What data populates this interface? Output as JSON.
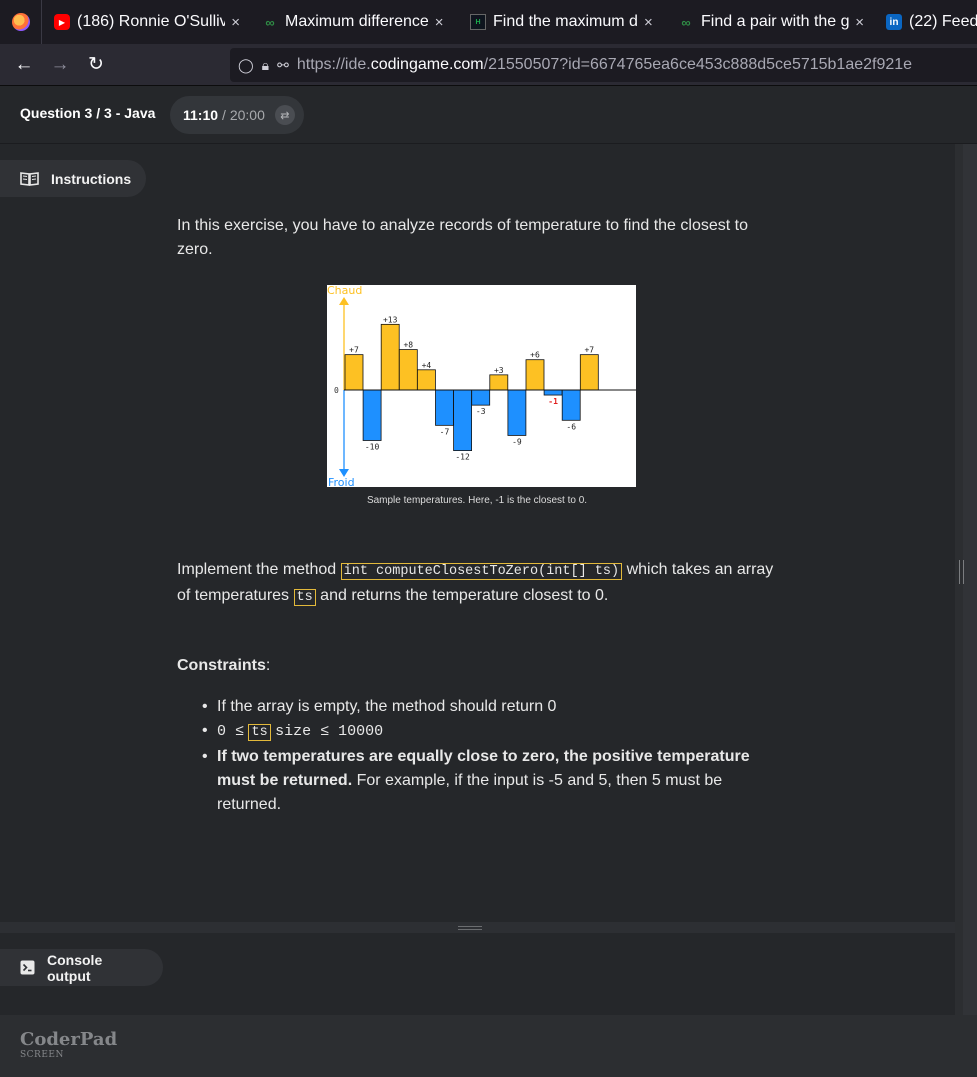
{
  "browser": {
    "tabs": [
      {
        "favicon": "youtube-icon",
        "title": "(186) Ronnie O'Sulliv"
      },
      {
        "favicon": "geeksforgeeks-icon",
        "title": "Maximum difference"
      },
      {
        "favicon": "hackerrank-icon",
        "title": "Find the maximum d"
      },
      {
        "favicon": "geeksforgeeks-icon",
        "title": "Find a pair with the g"
      },
      {
        "favicon": "linkedin-icon",
        "title": "(22) Feed"
      }
    ],
    "url_prefix": "https://ide.",
    "url_domain": "codingame.com",
    "url_path": "/21550507?id=6674765ea6ce453c888d5ce5715b1ae2f921e"
  },
  "header": {
    "question": "Question 3 / 3 - Java",
    "timer_current": "11:10",
    "timer_total": "/ 20:00"
  },
  "instructions": {
    "tab_label": "Instructions",
    "intro": "In this exercise, you have to analyze records of temperature to find the closest to zero.",
    "caption": "Sample temperatures. Here, -1 is the closest to 0.",
    "impl_before": "Implement the method",
    "impl_method": "int computeClosestToZero(int[] ts)",
    "impl_middle": "which takes an array of temperatures",
    "impl_param": "ts",
    "impl_after": "and returns the temperature closest to 0.",
    "constraints_title": "Constraints",
    "constraints_colon": ":",
    "c1": "If the array is empty, the method should return 0",
    "c2_before": "0 ≤",
    "c2_param": "ts",
    "c2_after": "size ≤ 10000",
    "c3_bold": "If two temperatures are equally close to zero, the positive temperature must be returned.",
    "c3_rest": "For example, if the input is -5 and 5, then 5 must be returned."
  },
  "console": {
    "tab_label": "Console output"
  },
  "footer": {
    "brand": "CoderPad",
    "sub": "SCREEN"
  },
  "chart_data": {
    "type": "bar",
    "top_label": "Chaud",
    "bottom_label": "Froid",
    "zero_label": "0",
    "values": [
      7,
      -10,
      13,
      8,
      4,
      -7,
      -12,
      -3,
      3,
      -9,
      6,
      -1,
      -6,
      7
    ],
    "labels": [
      "+7",
      "-10",
      "+13",
      "+8",
      "+4",
      "-7",
      "-12",
      "-3",
      "+3",
      "-9",
      "+6",
      "-1",
      "-6",
      "+7"
    ],
    "highlight": "-1",
    "colors": {
      "positive": "#fdc123",
      "negative": "#1e90ff",
      "highlight": "#e02020",
      "axis_top": "#fdc123",
      "axis_bottom": "#1e90ff"
    }
  }
}
